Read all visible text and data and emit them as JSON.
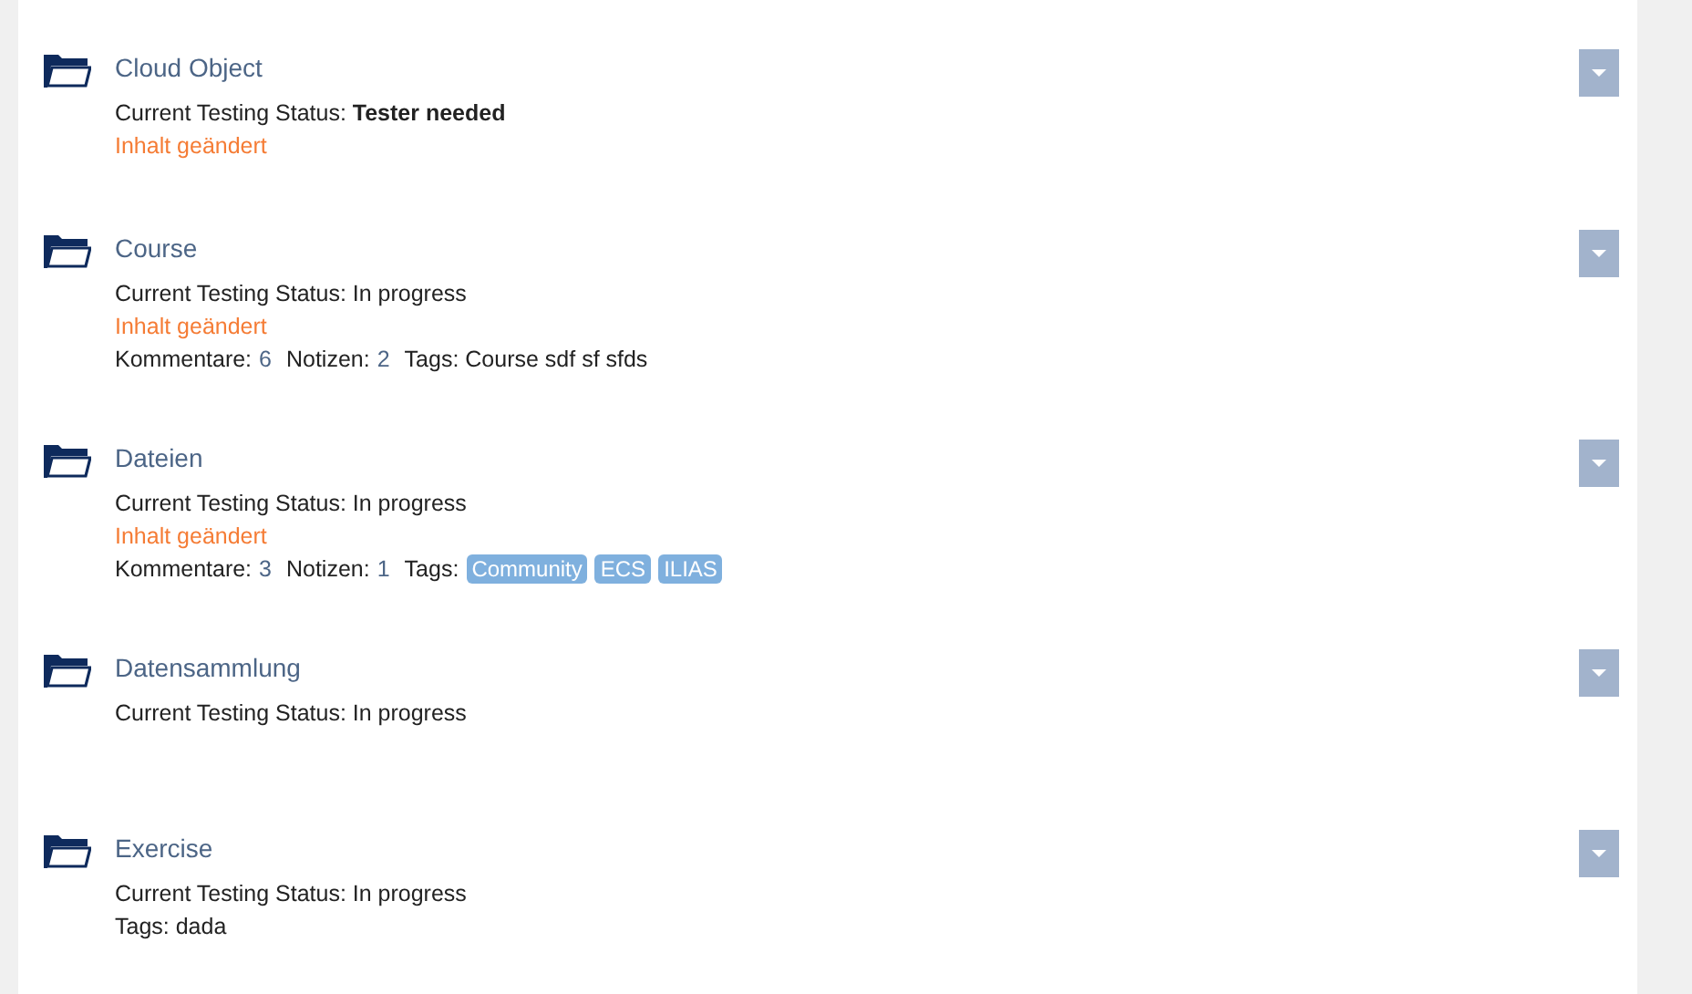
{
  "items": [
    {
      "title": "Cloud Object",
      "status": "Current Testing Status: **Tester needed**",
      "changed": "Inhalt geändert"
    },
    {
      "title": "Course",
      "status": "Current Testing Status: In progress",
      "changed": "Inhalt geändert",
      "meta": [
        {
          "kind": "count",
          "label": "Kommentare:",
          "value": "6"
        },
        {
          "kind": "count",
          "label": "Notizen:",
          "value": "2"
        },
        {
          "kind": "tags",
          "label": "Tags:",
          "value": "Course sdf sf sfds"
        }
      ]
    },
    {
      "title": "Dateien",
      "status": "Current Testing Status: In progress",
      "changed": "Inhalt geändert",
      "meta": [
        {
          "kind": "count",
          "label": "Kommentare:",
          "value": "3"
        },
        {
          "kind": "count",
          "label": "Notizen:",
          "value": "1"
        },
        {
          "kind": "badges",
          "label": "Tags:",
          "tags": [
            "Community",
            "ECS",
            "ILIAS"
          ]
        }
      ]
    },
    {
      "title": "Datensammlung",
      "status": "Current Testing Status: In progress"
    },
    {
      "title": "Exercise",
      "status": "Current Testing Status: In progress",
      "meta": [
        {
          "kind": "tags",
          "label": "Tags:",
          "value": "dada"
        }
      ]
    }
  ]
}
